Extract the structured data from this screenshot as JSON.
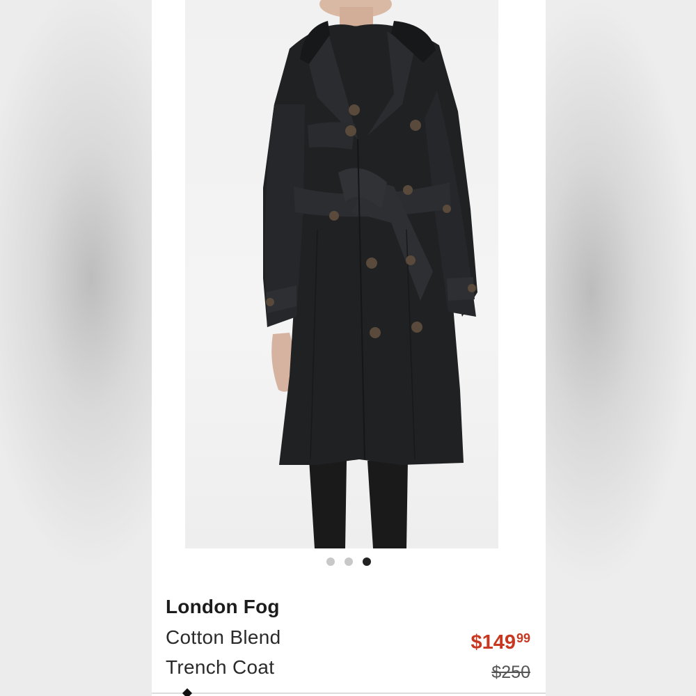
{
  "carousel": {
    "dot_count": 3,
    "active_index": 2
  },
  "product": {
    "brand": "London Fog",
    "title_line_1": "Cotton Blend",
    "title_line_2": "Trench Coat",
    "sale_price_main": "$149",
    "sale_price_cents": "99",
    "original_price": "$250"
  },
  "colors": {
    "sale_price": "#c8371f",
    "coat": "#1f2123",
    "active_dot": "#222222",
    "inactive_dot": "#c8c8c8"
  },
  "icons": [
    "tortoiseshell-button-icon"
  ]
}
